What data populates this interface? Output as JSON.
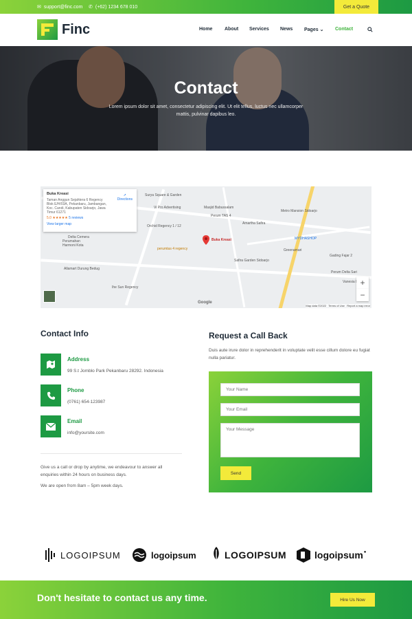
{
  "topbar": {
    "email": "support@finc.com",
    "phone": "(+62) 1234 678 010",
    "quote_button": "Get a Quote"
  },
  "header": {
    "brand": "Finc",
    "nav": [
      "Home",
      "About",
      "Services",
      "News",
      "Pages",
      "Contact"
    ],
    "active_nav": "Contact"
  },
  "hero": {
    "title": "Contact",
    "subtitle": "Lorem ipsum dolor sit amet, consectetur adipiscing elit. Ut elit tellus, luctus nec ullamcorper mattis, pulvinar dapibus leo."
  },
  "map": {
    "place_name": "Buka Kreasi",
    "place_address": "Taman Anggun Sejahtera 6 Regency Blok E/H/03A, Pekanbaru, Jambangan, Koc. Candi, Kabupaten Sidoarjo, Jawa Timur 61271",
    "rating": "5.0 ★★★★★",
    "reviews": "5 reviews",
    "view_larger": "View larger map",
    "directions": "Directions",
    "marker_label": "Buka Kreasi",
    "pois": [
      "Surya Square & Garden",
      "Vi Pro Advertising",
      "Masjid Babussalam",
      "Perum TAS 4",
      "Metro Mansion Sidoarjo",
      "Amartha Safira",
      "Orchid Regency 1 / 12",
      "Delta Cemera",
      "Perumahan Harmoni Kota",
      "perumtas 4 regency",
      "MYDHASHOP",
      "Greenamari",
      "Safira Garden Sidoarjo",
      "Gading Fajar 2",
      "Allamart Durung Bedug",
      "Ihe Sun Regency",
      "Perum Delta Sari",
      "Vanesia Pl",
      "Map data ©2022",
      "Terms of Use",
      "Report a map error"
    ],
    "zoom_in": "+",
    "zoom_out": "−",
    "attribution": "Google"
  },
  "contact_info": {
    "title": "Contact Info",
    "items": [
      {
        "label": "Address",
        "value": "99 S.t Jomblo Park Pekanbaru 28292. Indonesia",
        "icon": "map-icon"
      },
      {
        "label": "Phone",
        "value": "(0761) 654-123987",
        "icon": "phone-icon"
      },
      {
        "label": "Email",
        "value": "info@yoursite.com",
        "icon": "mail-icon"
      }
    ],
    "note1": "Give us a call or drop by anytime, we endeavour to answer all enquiries within 24 hours on business days.",
    "note2": "We are open from 8am – 5pm week days."
  },
  "callback": {
    "title": "Request a Call Back",
    "description": "Duis aute irure dolor in reprehenderit in voluptate velit esse cillum dolore eu fugiat nulla pariatur.",
    "name_placeholder": "Your Name",
    "email_placeholder": "Your Email",
    "message_placeholder": "Your Message",
    "send_button": "Send"
  },
  "logos": [
    "LOGOIPSUM",
    "logoipsum",
    "LOGOIPSUM",
    "logoipsum"
  ],
  "cta": {
    "text": "Don't hesitate to contact us any time.",
    "button": "Hire Us Now"
  },
  "colors": {
    "primary_green": "#1d9a43",
    "light_green": "#8bd23a",
    "accent_yellow": "#f3ea3a"
  }
}
